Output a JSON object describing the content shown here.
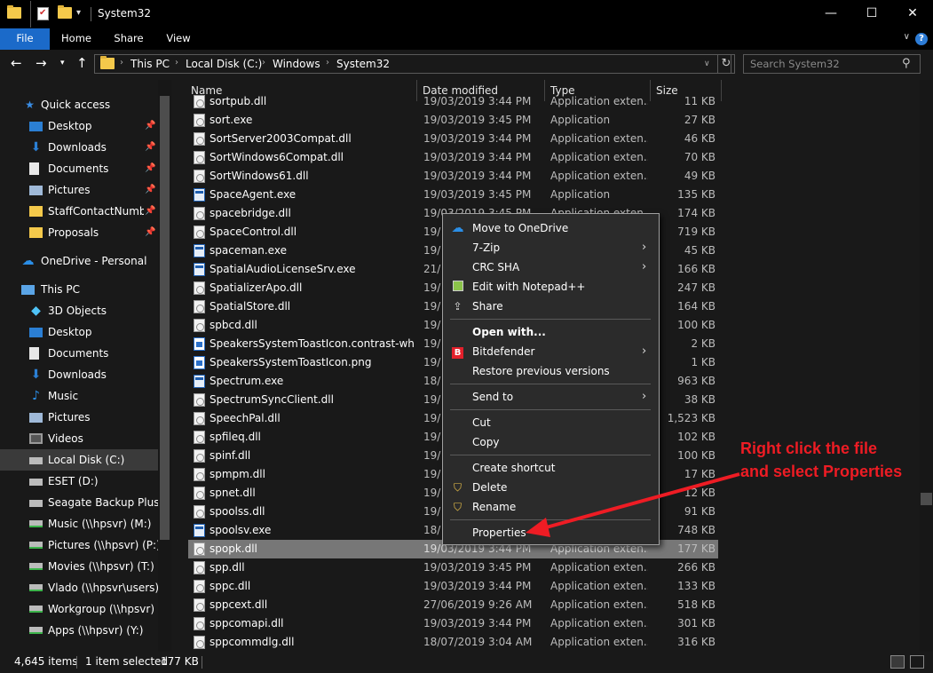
{
  "window": {
    "title": "System32",
    "minimize_label": "—",
    "maximize_label": "☐",
    "close_label": "✕"
  },
  "ribbon": {
    "tabs": [
      "File",
      "Home",
      "Share",
      "View"
    ],
    "help_label": "?"
  },
  "address": {
    "crumbs": [
      "This PC",
      "Local Disk (C:)",
      "Windows",
      "System32"
    ],
    "search_placeholder": "Search System32"
  },
  "sidebar": {
    "quick_access": "Quick access",
    "quick_items": [
      "Desktop",
      "Downloads",
      "Documents",
      "Pictures",
      "StaffContactNumbe",
      "Proposals"
    ],
    "onedrive": "OneDrive - Personal",
    "this_pc": "This PC",
    "pc_items": [
      "3D Objects",
      "Desktop",
      "Documents",
      "Downloads",
      "Music",
      "Pictures",
      "Videos",
      "Local Disk (C:)",
      "ESET (D:)",
      "Seagate Backup Plus Dr",
      "Music (\\\\hpsvr) (M:)",
      "Pictures (\\\\hpsvr) (P:)",
      "Movies (\\\\hpsvr) (T:)",
      "Vlado (\\\\hpsvr\\users) (U",
      "Workgroup (\\\\hpsvr) (W",
      "Apps (\\\\hpsvr) (Y:)"
    ]
  },
  "columns": [
    "Name",
    "Date modified",
    "Type",
    "Size"
  ],
  "files": [
    {
      "name": "sortpub.dll",
      "date": "19/03/2019 3:44 PM",
      "type": "Application exten...",
      "size": "11 KB",
      "kind": "dll"
    },
    {
      "name": "sort.exe",
      "date": "19/03/2019 3:45 PM",
      "type": "Application",
      "size": "27 KB",
      "kind": "dll"
    },
    {
      "name": "SortServer2003Compat.dll",
      "date": "19/03/2019 3:44 PM",
      "type": "Application exten...",
      "size": "46 KB",
      "kind": "dll"
    },
    {
      "name": "SortWindows6Compat.dll",
      "date": "19/03/2019 3:44 PM",
      "type": "Application exten...",
      "size": "70 KB",
      "kind": "dll"
    },
    {
      "name": "SortWindows61.dll",
      "date": "19/03/2019 3:44 PM",
      "type": "Application exten...",
      "size": "49 KB",
      "kind": "dll"
    },
    {
      "name": "SpaceAgent.exe",
      "date": "19/03/2019 3:45 PM",
      "type": "Application",
      "size": "135 KB",
      "kind": "exe"
    },
    {
      "name": "spacebridge.dll",
      "date": "19/03/2019 3:45 PM",
      "type": "Application exten...",
      "size": "174 KB",
      "kind": "dll"
    },
    {
      "name": "SpaceControl.dll",
      "date": "19/",
      "type": "",
      "size": "719 KB",
      "kind": "dll"
    },
    {
      "name": "spaceman.exe",
      "date": "19/",
      "type": "",
      "size": "45 KB",
      "kind": "exe"
    },
    {
      "name": "SpatialAudioLicenseSrv.exe",
      "date": "21/",
      "type": "",
      "size": "166 KB",
      "kind": "exe"
    },
    {
      "name": "SpatializerApo.dll",
      "date": "19/",
      "type": "",
      "size": "247 KB",
      "kind": "dll"
    },
    {
      "name": "SpatialStore.dll",
      "date": "19/",
      "type": "",
      "size": "164 KB",
      "kind": "dll"
    },
    {
      "name": "spbcd.dll",
      "date": "19/",
      "type": "",
      "size": "100 KB",
      "kind": "dll"
    },
    {
      "name": "SpeakersSystemToastIcon.contrast-white....",
      "date": "19/",
      "type": "",
      "size": "2 KB",
      "kind": "png"
    },
    {
      "name": "SpeakersSystemToastIcon.png",
      "date": "19/",
      "type": "",
      "size": "1 KB",
      "kind": "png"
    },
    {
      "name": "Spectrum.exe",
      "date": "18/",
      "type": "",
      "size": "963 KB",
      "kind": "exe"
    },
    {
      "name": "SpectrumSyncClient.dll",
      "date": "19/",
      "type": "",
      "size": "38 KB",
      "kind": "dll"
    },
    {
      "name": "SpeechPal.dll",
      "date": "19/",
      "type": "",
      "size": "1,523 KB",
      "kind": "dll"
    },
    {
      "name": "spfileq.dll",
      "date": "19/",
      "type": "",
      "size": "102 KB",
      "kind": "dll"
    },
    {
      "name": "spinf.dll",
      "date": "19/",
      "type": "",
      "size": "100 KB",
      "kind": "dll"
    },
    {
      "name": "spmpm.dll",
      "date": "19/",
      "type": "",
      "size": "17 KB",
      "kind": "dll"
    },
    {
      "name": "spnet.dll",
      "date": "19/",
      "type": "",
      "size": "12 KB",
      "kind": "dll"
    },
    {
      "name": "spoolss.dll",
      "date": "19/",
      "type": "",
      "size": "91 KB",
      "kind": "dll"
    },
    {
      "name": "spoolsv.exe",
      "date": "18/",
      "type": "",
      "size": "748 KB",
      "kind": "exe"
    },
    {
      "name": "spopk.dll",
      "date": "19/03/2019 3:44 PM",
      "type": "Application exten...",
      "size": "177 KB",
      "kind": "dll",
      "selected": true
    },
    {
      "name": "spp.dll",
      "date": "19/03/2019 3:45 PM",
      "type": "Application exten...",
      "size": "266 KB",
      "kind": "dll"
    },
    {
      "name": "sppc.dll",
      "date": "19/03/2019 3:44 PM",
      "type": "Application exten...",
      "size": "133 KB",
      "kind": "dll"
    },
    {
      "name": "sppcext.dll",
      "date": "27/06/2019 9:26 AM",
      "type": "Application exten...",
      "size": "518 KB",
      "kind": "dll"
    },
    {
      "name": "sppcomapi.dll",
      "date": "19/03/2019 3:44 PM",
      "type": "Application exten...",
      "size": "301 KB",
      "kind": "dll"
    },
    {
      "name": "sppcommdlg.dll",
      "date": "18/07/2019 3:04 AM",
      "type": "Application exten...",
      "size": "316 KB",
      "kind": "dll"
    }
  ],
  "context_menu": [
    {
      "label": "Move to OneDrive",
      "icon": "onedrive-icon",
      "sep_after": false
    },
    {
      "label": "7-Zip",
      "submenu": true
    },
    {
      "label": "CRC SHA",
      "submenu": true
    },
    {
      "label": "Edit with Notepad++",
      "icon": "notepad-icon"
    },
    {
      "label": "Share",
      "icon": "share-icon",
      "sep_after": true
    },
    {
      "label": "Open with...",
      "bold": true
    },
    {
      "label": "Bitdefender",
      "icon": "bitdefender-icon",
      "submenu": true
    },
    {
      "label": "Restore previous versions",
      "sep_after": true
    },
    {
      "label": "Send to",
      "submenu": true,
      "sep_after": true
    },
    {
      "label": "Cut"
    },
    {
      "label": "Copy",
      "sep_after": true
    },
    {
      "label": "Create shortcut"
    },
    {
      "label": "Delete",
      "icon": "shield-icon"
    },
    {
      "label": "Rename",
      "icon": "shield-icon",
      "sep_after": true
    },
    {
      "label": "Properties"
    }
  ],
  "status": {
    "items_count": "4,645 items",
    "selected": "1 item selected",
    "selected_size": "177 KB"
  },
  "annotation": {
    "line1": "Right click the file",
    "line2": "and select Properties",
    "color": "#ee1c24"
  }
}
